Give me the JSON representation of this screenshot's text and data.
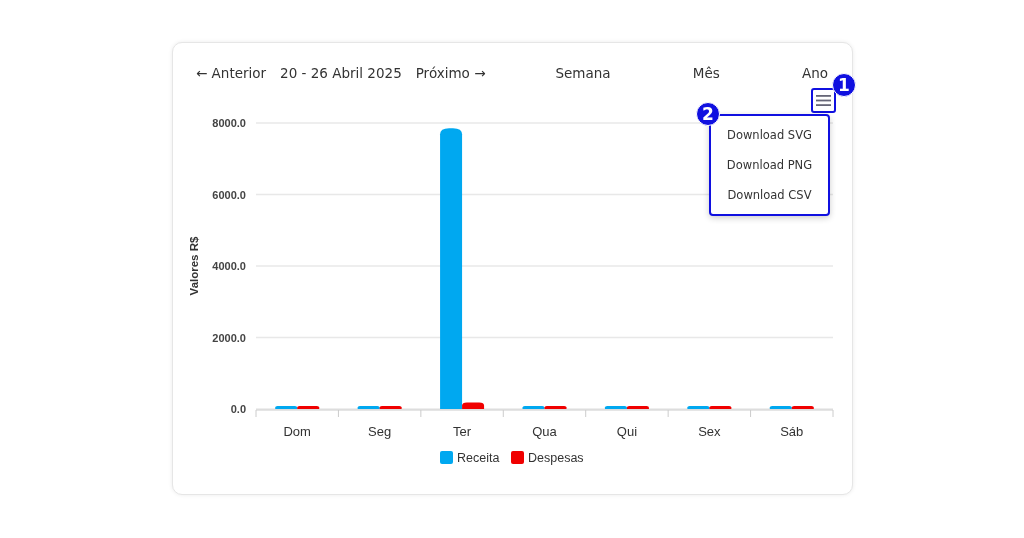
{
  "nav": {
    "previous": "← Anterior",
    "range": "20 - 26 Abril 2025",
    "next": "Próximo →",
    "periods": [
      "Semana",
      "Mês",
      "Ano"
    ]
  },
  "menu": {
    "items": [
      "Download SVG",
      "Download PNG",
      "Download CSV"
    ]
  },
  "annotations": [
    {
      "label": "1"
    },
    {
      "label": "2"
    }
  ],
  "chart_data": {
    "type": "bar",
    "ylabel": "Valores R$",
    "categories": [
      "Dom",
      "Seg",
      "Ter",
      "Qua",
      "Qui",
      "Sex",
      "Sáb"
    ],
    "series": [
      {
        "name": "Receita",
        "color": "#00a8f0",
        "values": [
          0,
          0,
          7850,
          0,
          0,
          0,
          0
        ]
      },
      {
        "name": "Despesas",
        "color": "#f00000",
        "values": [
          0,
          0,
          180,
          0,
          0,
          0,
          0
        ]
      }
    ],
    "grid": true,
    "legend": true,
    "ylim": [
      0,
      8000
    ],
    "yticks": [
      {
        "value": 0,
        "label": "0.0"
      },
      {
        "value": 2000,
        "label": "2000.0"
      },
      {
        "value": 4000,
        "label": "4000.0"
      },
      {
        "value": 6000,
        "label": "6000.0"
      },
      {
        "value": 8000,
        "label": "8000.0"
      }
    ]
  }
}
